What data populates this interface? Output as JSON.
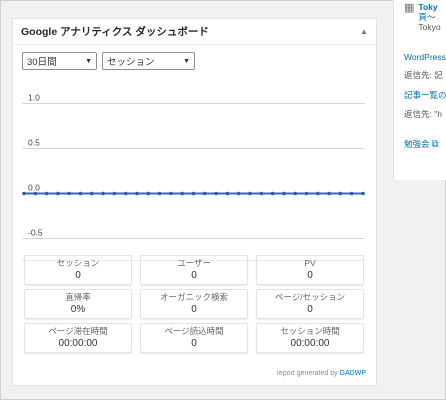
{
  "widget": {
    "title": "Google アナリティクス ダッシュボード",
    "collapse_icon": "triangle-up-icon",
    "period_select": "30日間",
    "metric_select": "セッション"
  },
  "chart_data": {
    "type": "line",
    "yticks": [
      "1.0",
      "0.5",
      "0.0",
      "-0.5"
    ],
    "ylim": [
      -0.75,
      1.25
    ],
    "series": [
      {
        "values": [
          0,
          0,
          0,
          0,
          0,
          0,
          0,
          0,
          0,
          0,
          0,
          0,
          0,
          0,
          0,
          0,
          0,
          0,
          0,
          0,
          0,
          0,
          0,
          0,
          0,
          0,
          0,
          0,
          0,
          0,
          0
        ]
      }
    ],
    "grid": true,
    "colors": {
      "line": "#3366cc",
      "point": "#2d5aa8"
    }
  },
  "metrics": [
    {
      "label": "セッション",
      "value": "0"
    },
    {
      "label": "ユーザー",
      "value": "0"
    },
    {
      "label": "PV",
      "value": "0"
    },
    {
      "label": "直帰率",
      "value": "0%"
    },
    {
      "label": "オーガニック検索",
      "value": "0"
    },
    {
      "label": "ページ/セッション",
      "value": "0"
    },
    {
      "label": "ページ滞在時間",
      "value": "00:00:00"
    },
    {
      "label": "ページ読込時間",
      "value": "0"
    },
    {
      "label": "セッション時間",
      "value": "00:00:00"
    }
  ],
  "footer": {
    "prefix": "report generated by",
    "link": "GADWP"
  },
  "right_panel": {
    "event_icon": "calendar-icon",
    "event_title": "Toky",
    "event_date": "頁〜",
    "event_place": "Tokyo",
    "items": [
      {
        "text": "WordPress",
        "style": "link"
      },
      {
        "text": "返信先: 記",
        "style": "gray"
      },
      {
        "text": "記事一覧の",
        "style": "link"
      },
      {
        "text": "返信先: \"h",
        "style": "gray"
      }
    ],
    "meetup_label": "勉強会",
    "meetup_icon": "external-link-icon"
  }
}
